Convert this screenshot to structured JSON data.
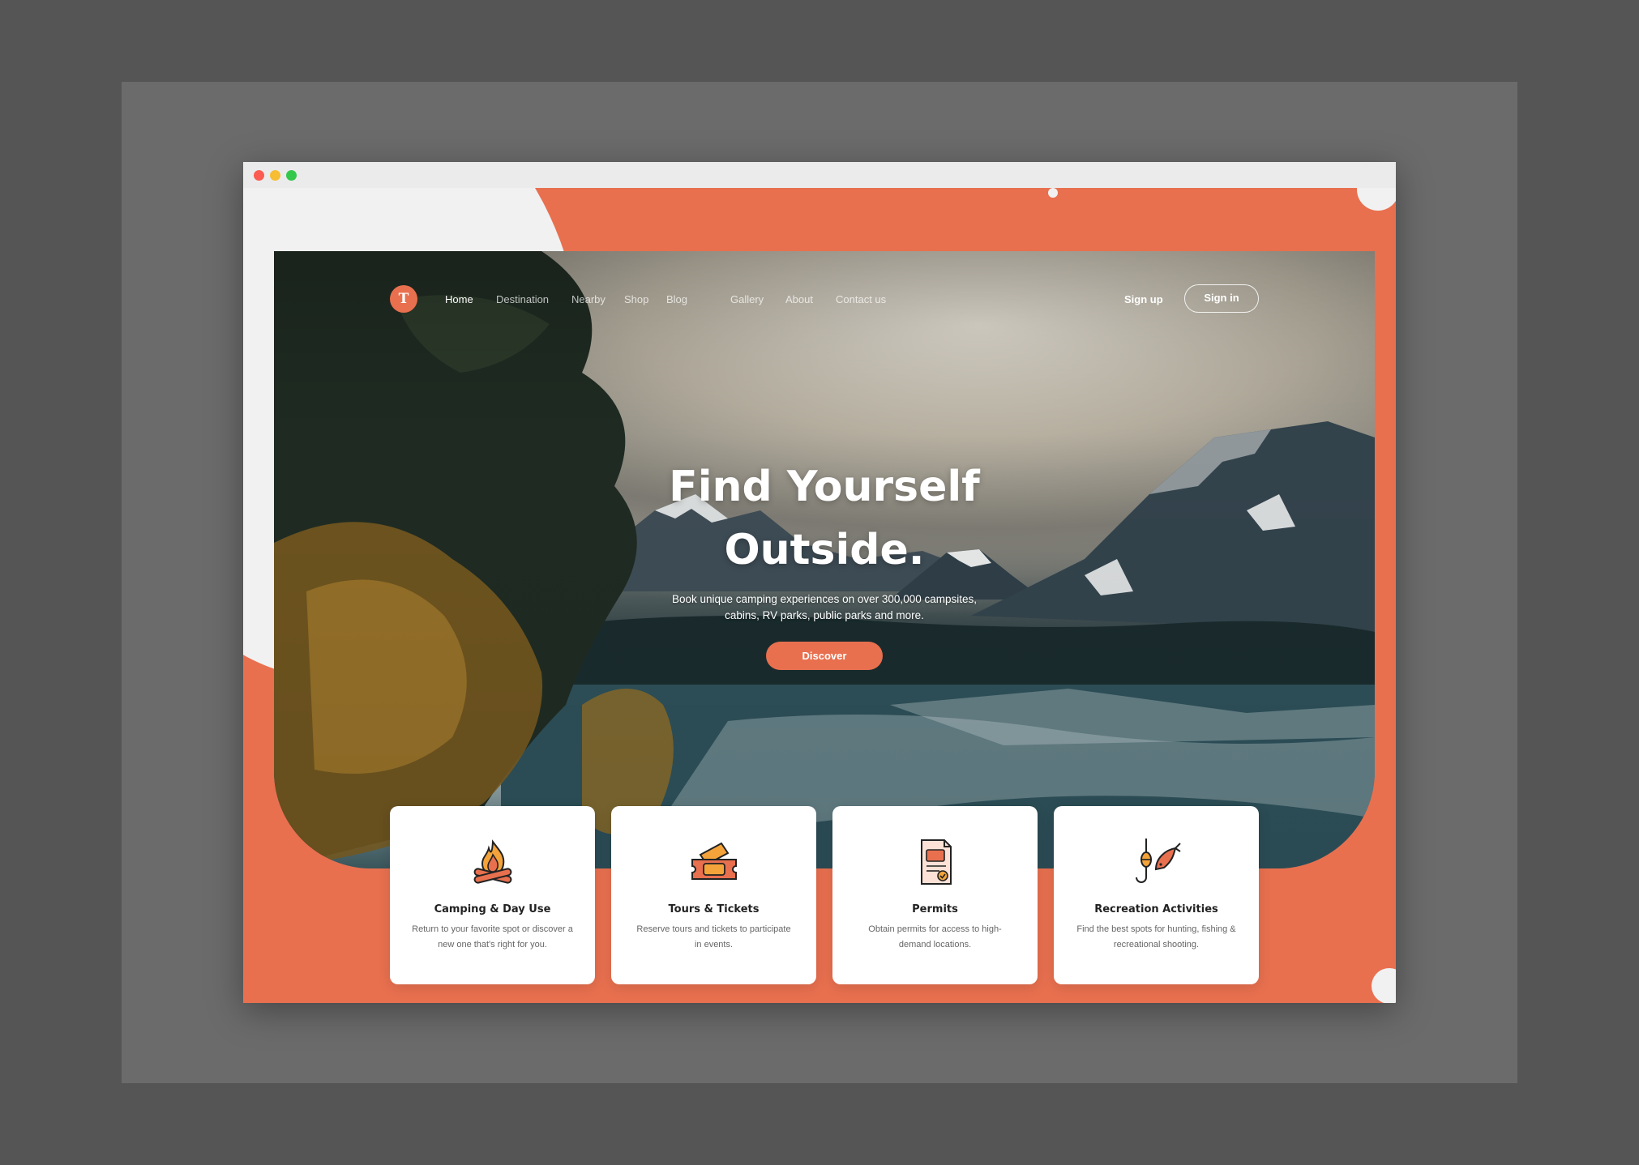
{
  "colors": {
    "accent": "#e8704f",
    "board": "#6b6b6b",
    "background": "#555555",
    "light": "#f1f1f1"
  },
  "window": {
    "controls": [
      "close",
      "minimize",
      "maximize"
    ]
  },
  "nav": {
    "logo_glyph": "T",
    "links": [
      {
        "label": "Home",
        "active": true
      },
      {
        "label": "Destination",
        "active": false
      },
      {
        "label": "Nearby",
        "active": false
      },
      {
        "label": "Shop",
        "active": false
      },
      {
        "label": "Blog",
        "active": false
      },
      {
        "label": "Gallery",
        "active": false
      },
      {
        "label": "About",
        "active": false
      },
      {
        "label": "Contact us",
        "active": false
      }
    ],
    "signup_label": "Sign up",
    "signin_label": "Sign in"
  },
  "hero": {
    "headline_line1": "Find Yourself",
    "headline_line2": "Outside.",
    "subhead_line1": "Book unique camping experiences on over 300,000 campsites,",
    "subhead_line2": "cabins, RV parks, public parks and more.",
    "cta_label": "Discover"
  },
  "cards": [
    {
      "icon": "campfire-icon",
      "title": "Camping & Day Use",
      "description": "Return to your favorite spot or discover a new one that's right for you."
    },
    {
      "icon": "tickets-icon",
      "title": "Tours & Tickets",
      "description": "Reserve tours and tickets to participate in events."
    },
    {
      "icon": "permit-document-icon",
      "title": "Permits",
      "description": "Obtain permits for access to high-demand locations."
    },
    {
      "icon": "fishing-hook-icon",
      "title": "Recreation Activities",
      "description": "Find the best spots for hunting, fishing & recreational shooting."
    }
  ]
}
